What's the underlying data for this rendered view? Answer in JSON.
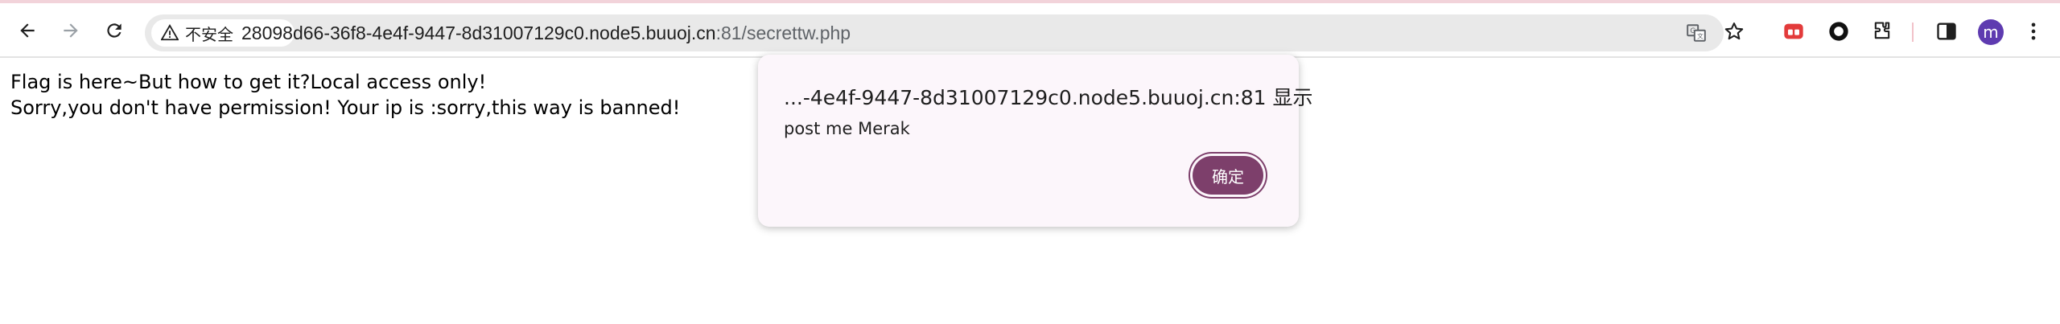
{
  "browser": {
    "security_label": "不安全",
    "url_main": "28098d66-36f8-4e4f-9447-8d31007129c0.node5.buuoj.cn",
    "url_rest": ":81/secrettw.php",
    "profile_initial": "m",
    "icons": {
      "back": "back-arrow-icon",
      "forward": "forward-arrow-icon",
      "reload": "reload-icon",
      "warning": "warning-icon",
      "translate": "translate-icon",
      "bookmark": "star-icon",
      "extensions": "puzzle-icon",
      "side_panel": "side-panel-icon",
      "menu": "kebab-menu-icon"
    },
    "colors": {
      "accent_button": "#7d3f6b",
      "avatar": "#5e3bb0",
      "dialog_bg": "#fcf6fb"
    }
  },
  "page": {
    "line1": "Flag is here~But how to get it?Local access only!",
    "line2": "Sorry,you don't have permission! Your ip is :sorry,this way is banned!"
  },
  "dialog": {
    "title": "...-4e4f-9447-8d31007129c0.node5.buuoj.cn:81 显示",
    "message": "post me Merak",
    "ok_label": "确定"
  }
}
